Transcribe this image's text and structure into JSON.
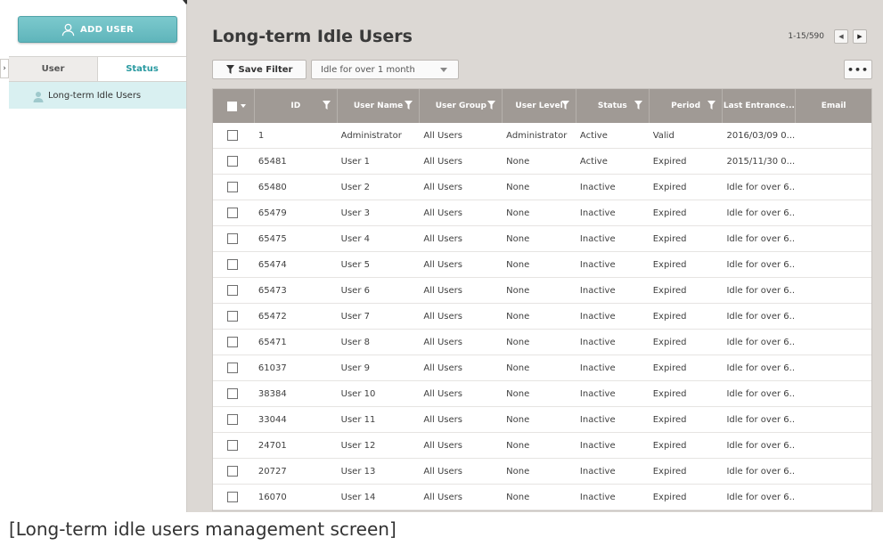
{
  "sidebar": {
    "add_user_label": "ADD USER",
    "tabs": [
      "User",
      "Status"
    ],
    "active_tab": "Status",
    "tree_item": "Long-term Idle Users"
  },
  "header": {
    "title": "Long-term Idle Users",
    "pagination": "1-15/590"
  },
  "toolbar": {
    "save_filter_label": "Save Filter",
    "filter_value": "Idle for over 1 month",
    "more_label": "•••"
  },
  "table": {
    "columns": [
      "ID",
      "User Name",
      "User Group",
      "User Level",
      "Status",
      "Period",
      "Last Entrance...",
      "Email"
    ],
    "rows": [
      [
        "1",
        "Administrator",
        "All Users",
        "Administrator",
        "Active",
        "Valid",
        "2016/03/09 0...",
        ""
      ],
      [
        "65481",
        "User 1",
        "All Users",
        "None",
        "Active",
        "Expired",
        "2015/11/30 0...",
        ""
      ],
      [
        "65480",
        "User 2",
        "All Users",
        "None",
        "Inactive",
        "Expired",
        "Idle for over 6...",
        ""
      ],
      [
        "65479",
        "User 3",
        "All Users",
        "None",
        "Inactive",
        "Expired",
        "Idle for over 6...",
        ""
      ],
      [
        "65475",
        "User 4",
        "All Users",
        "None",
        "Inactive",
        "Expired",
        "Idle for over 6...",
        ""
      ],
      [
        "65474",
        "User 5",
        "All Users",
        "None",
        "Inactive",
        "Expired",
        "Idle for over 6...",
        ""
      ],
      [
        "65473",
        "User 6",
        "All Users",
        "None",
        "Inactive",
        "Expired",
        "Idle for over 6...",
        ""
      ],
      [
        "65472",
        "User 7",
        "All Users",
        "None",
        "Inactive",
        "Expired",
        "Idle for over 6...",
        ""
      ],
      [
        "65471",
        "User 8",
        "All Users",
        "None",
        "Inactive",
        "Expired",
        "Idle for over 6...",
        ""
      ],
      [
        "61037",
        "User 9",
        "All Users",
        "None",
        "Inactive",
        "Expired",
        "Idle for over 6...",
        ""
      ],
      [
        "38384",
        "User 10",
        "All Users",
        "None",
        "Inactive",
        "Expired",
        "Idle for over 6...",
        ""
      ],
      [
        "33044",
        "User 11",
        "All Users",
        "None",
        "Inactive",
        "Expired",
        "Idle for over 6...",
        ""
      ],
      [
        "24701",
        "User 12",
        "All Users",
        "None",
        "Inactive",
        "Expired",
        "Idle for over 6...",
        ""
      ],
      [
        "20727",
        "User 13",
        "All Users",
        "None",
        "Inactive",
        "Expired",
        "Idle for over 6...",
        ""
      ],
      [
        "16070",
        "User 14",
        "All Users",
        "None",
        "Inactive",
        "Expired",
        "Idle for over 6...",
        ""
      ]
    ]
  },
  "caption": "[Long-term idle users management screen]",
  "colors": {
    "accent": "#5fb5bb",
    "table_header": "#a09a95",
    "main_bg": "#dcd8d4"
  }
}
